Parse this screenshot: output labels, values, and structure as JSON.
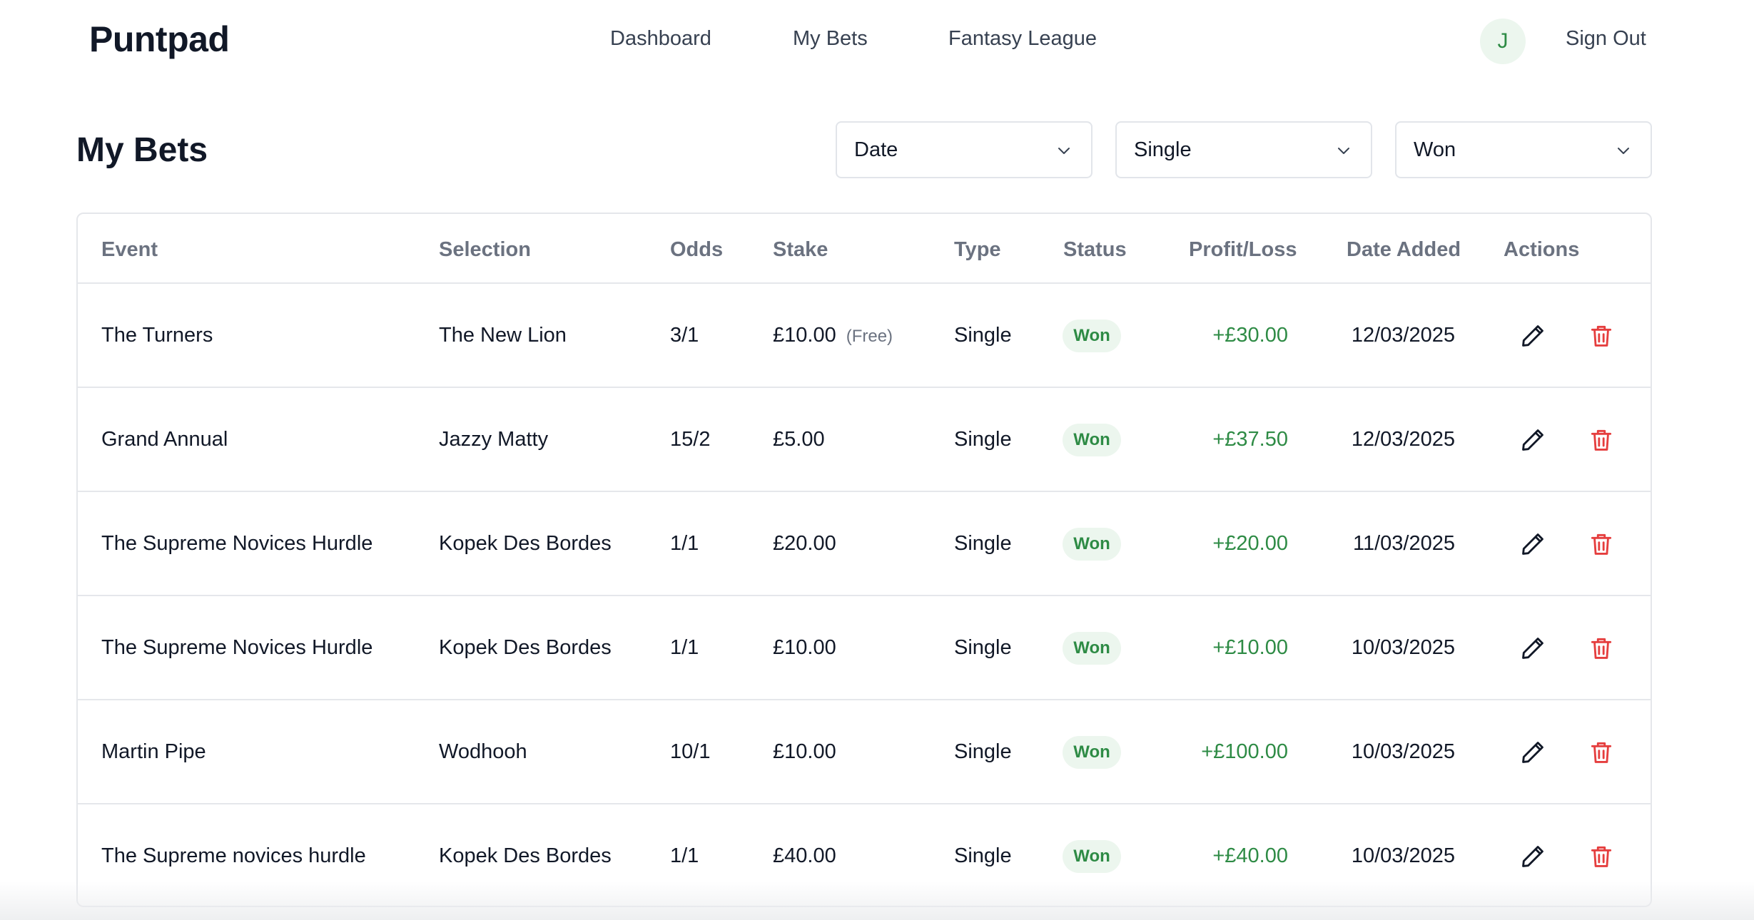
{
  "app": {
    "logo": "Puntpad",
    "nav": [
      {
        "label": "Dashboard"
      },
      {
        "label": "My Bets"
      },
      {
        "label": "Fantasy League"
      }
    ],
    "avatar_initial": "J",
    "sign_out": "Sign Out"
  },
  "page": {
    "title": "My Bets"
  },
  "filters": {
    "sort": "Date",
    "type": "Single",
    "status": "Won"
  },
  "table": {
    "columns": [
      "Event",
      "Selection",
      "Odds",
      "Stake",
      "Type",
      "Status",
      "Profit/Loss",
      "Date Added",
      "Actions"
    ],
    "rows": [
      {
        "event": "The Turners",
        "selection": "The New Lion",
        "odds": "3/1",
        "stake": "£10.00",
        "stake_note": "(Free)",
        "type": "Single",
        "status": "Won",
        "pl": "+£30.00",
        "date": "12/03/2025"
      },
      {
        "event": "Grand Annual",
        "selection": "Jazzy Matty",
        "odds": "15/2",
        "stake": "£5.00",
        "stake_note": "",
        "type": "Single",
        "status": "Won",
        "pl": "+£37.50",
        "date": "12/03/2025"
      },
      {
        "event": "The Supreme Novices Hurdle",
        "selection": "Kopek Des Bordes",
        "odds": "1/1",
        "stake": "£20.00",
        "stake_note": "",
        "type": "Single",
        "status": "Won",
        "pl": "+£20.00",
        "date": "11/03/2025"
      },
      {
        "event": "The Supreme Novices Hurdle",
        "selection": "Kopek Des Bordes",
        "odds": "1/1",
        "stake": "£10.00",
        "stake_note": "",
        "type": "Single",
        "status": "Won",
        "pl": "+£10.00",
        "date": "10/03/2025"
      },
      {
        "event": "Martin Pipe",
        "selection": "Wodhooh",
        "odds": "10/1",
        "stake": "£10.00",
        "stake_note": "",
        "type": "Single",
        "status": "Won",
        "pl": "+£100.00",
        "date": "10/03/2025"
      },
      {
        "event": "The Supreme novices hurdle",
        "selection": "Kopek Des Bordes",
        "odds": "1/1",
        "stake": "£40.00",
        "stake_note": "",
        "type": "Single",
        "status": "Won",
        "pl": "+£40.00",
        "date": "10/03/2025"
      }
    ]
  },
  "icons": {
    "edit": "pencil-icon",
    "delete": "trash-icon",
    "dropdown": "chevron-down-icon"
  },
  "colors": {
    "profit_green": "#2e8b45",
    "badge_bg": "#ecf6ee",
    "delete_red": "#e53e3e"
  }
}
